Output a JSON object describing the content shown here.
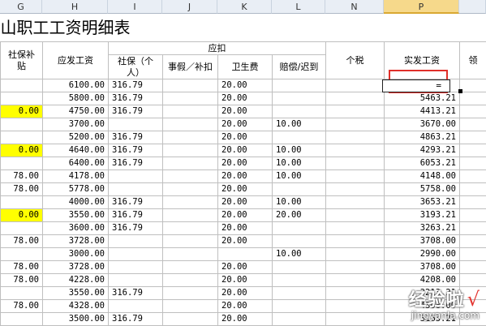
{
  "columns": [
    "G",
    "H",
    "I",
    "J",
    "K",
    "L",
    "N",
    "P"
  ],
  "title": "山职工工资明细表",
  "headers": {
    "g": "社保补贴",
    "h": "应发工资",
    "deduct": "应扣",
    "i": "社保（个人）",
    "j": "事假／补扣",
    "k": "卫生费",
    "l": "赔偿/迟到",
    "n": "个税",
    "p": "实发工资",
    "q": "领"
  },
  "rows": [
    {
      "g": "",
      "h": "6100.00",
      "i": "316.79",
      "j": "",
      "k": "20.00",
      "l": "",
      "n": "",
      "p": ""
    },
    {
      "g": "",
      "h": "5800.00",
      "i": "316.79",
      "j": "",
      "k": "20.00",
      "l": "",
      "n": "",
      "p": "5463.21"
    },
    {
      "g": "0.00",
      "h": "4750.00",
      "i": "316.79",
      "j": "",
      "k": "20.00",
      "l": "",
      "n": "",
      "p": "4413.21"
    },
    {
      "g": "",
      "h": "3700.00",
      "i": "",
      "j": "",
      "k": "20.00",
      "l": "10.00",
      "n": "",
      "p": "3670.00"
    },
    {
      "g": "",
      "h": "5200.00",
      "i": "316.79",
      "j": "",
      "k": "20.00",
      "l": "",
      "n": "",
      "p": "4863.21"
    },
    {
      "g": "0.00",
      "h": "4640.00",
      "i": "316.79",
      "j": "",
      "k": "20.00",
      "l": "10.00",
      "n": "",
      "p": "4293.21"
    },
    {
      "g": "",
      "h": "6400.00",
      "i": "316.79",
      "j": "",
      "k": "20.00",
      "l": "10.00",
      "n": "",
      "p": "6053.21"
    },
    {
      "g": "78.00",
      "h": "4178.00",
      "i": "",
      "j": "",
      "k": "20.00",
      "l": "10.00",
      "n": "",
      "p": "4148.00"
    },
    {
      "g": "78.00",
      "h": "5778.00",
      "i": "",
      "j": "",
      "k": "20.00",
      "l": "",
      "n": "",
      "p": "5758.00"
    },
    {
      "g": "",
      "h": "4000.00",
      "i": "316.79",
      "j": "",
      "k": "20.00",
      "l": "10.00",
      "n": "",
      "p": "3653.21"
    },
    {
      "g": "0.00",
      "h": "3550.00",
      "i": "316.79",
      "j": "",
      "k": "20.00",
      "l": "20.00",
      "n": "",
      "p": "3193.21"
    },
    {
      "g": "",
      "h": "3600.00",
      "i": "316.79",
      "j": "",
      "k": "20.00",
      "l": "",
      "n": "",
      "p": "3263.21"
    },
    {
      "g": "78.00",
      "h": "3728.00",
      "i": "",
      "j": "",
      "k": "20.00",
      "l": "",
      "n": "",
      "p": "3708.00"
    },
    {
      "g": "",
      "h": "3000.00",
      "i": "",
      "j": "",
      "k": "",
      "l": "10.00",
      "n": "",
      "p": "2990.00"
    },
    {
      "g": "78.00",
      "h": "3728.00",
      "i": "",
      "j": "",
      "k": "20.00",
      "l": "",
      "n": "",
      "p": "3708.00"
    },
    {
      "g": "78.00",
      "h": "4228.00",
      "i": "",
      "j": "",
      "k": "20.00",
      "l": "",
      "n": "",
      "p": "4208.00"
    },
    {
      "g": "",
      "h": "3550.00",
      "i": "316.79",
      "j": "",
      "k": "20.00",
      "l": "",
      "n": "",
      "p": "3213.21"
    },
    {
      "g": "78.00",
      "h": "4328.00",
      "i": "",
      "j": "",
      "k": "20.00",
      "l": "",
      "n": "",
      "p": "4308.00"
    },
    {
      "g": "",
      "h": "3500.00",
      "i": "316.79",
      "j": "",
      "k": "20.00",
      "l": "",
      "n": "",
      "p": "3163.21"
    }
  ],
  "yellow_rows": [
    2,
    5,
    10
  ],
  "active_cell": {
    "formula": "="
  },
  "colors": {
    "highlight": "#ffff00",
    "selection": "#e0302a"
  },
  "watermark": {
    "main": "经验啦",
    "check": "√",
    "sub": "jingyanla.com"
  }
}
